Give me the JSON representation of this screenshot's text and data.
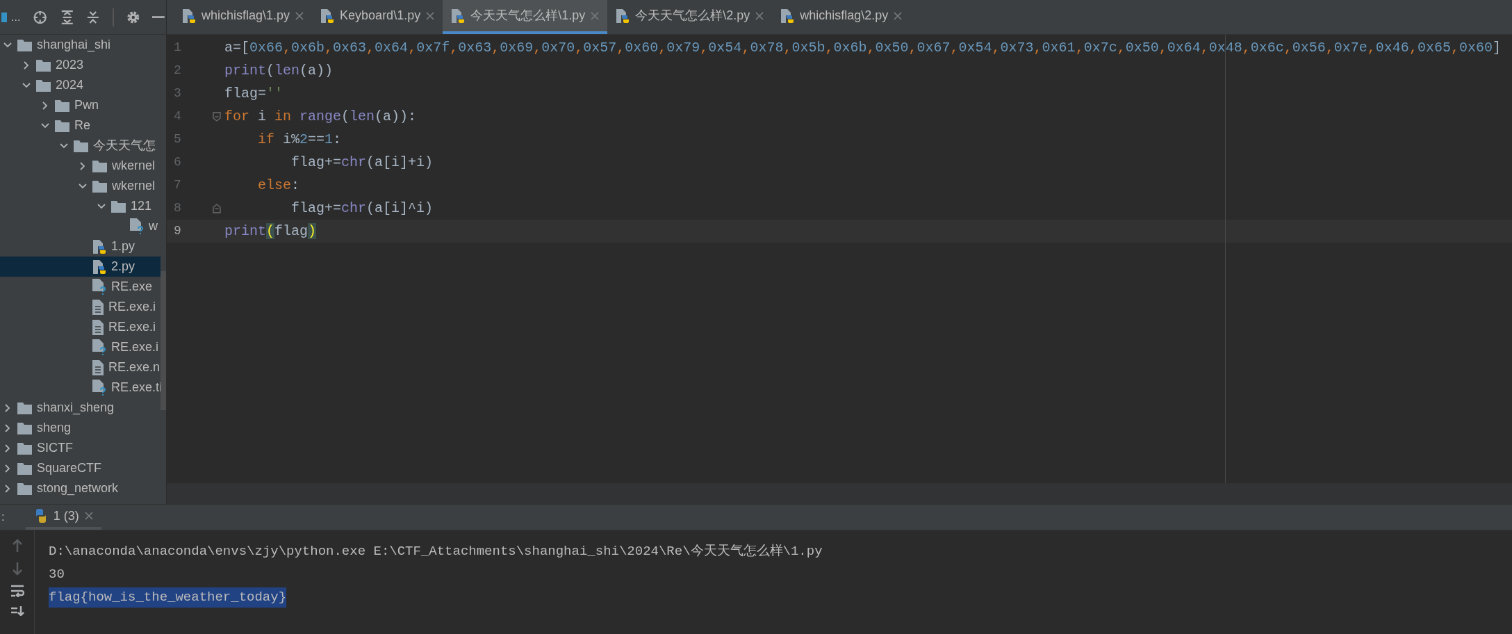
{
  "project_panel": {
    "title": "...",
    "tree": [
      {
        "label": "shanghai_shi",
        "kind": "folder",
        "expanded": true,
        "selected": false,
        "children": [
          {
            "label": "2023",
            "kind": "folder",
            "expanded": false,
            "selected": false
          },
          {
            "label": "2024",
            "kind": "folder",
            "expanded": true,
            "selected": false,
            "children": [
              {
                "label": "Pwn",
                "kind": "folder",
                "expanded": false,
                "selected": false
              },
              {
                "label": "Re",
                "kind": "folder",
                "expanded": true,
                "selected": false,
                "children": [
                  {
                    "label": "今天天气怎",
                    "kind": "folder",
                    "expanded": true,
                    "selected": false,
                    "children": [
                      {
                        "label": "wkernel",
                        "kind": "folder",
                        "expanded": false,
                        "selected": false
                      },
                      {
                        "label": "wkernel",
                        "kind": "folder",
                        "expanded": true,
                        "selected": false,
                        "children": [
                          {
                            "label": "121",
                            "kind": "folder",
                            "expanded": true,
                            "selected": false,
                            "children": [
                              {
                                "label": "w",
                                "kind": "unknown",
                                "selected": false
                              }
                            ]
                          }
                        ]
                      },
                      {
                        "label": "1.py",
                        "kind": "python",
                        "selected": false
                      },
                      {
                        "label": "2.py",
                        "kind": "python",
                        "selected": true
                      },
                      {
                        "label": "RE.exe",
                        "kind": "unknown",
                        "selected": false
                      },
                      {
                        "label": "RE.exe.i",
                        "kind": "text",
                        "selected": false
                      },
                      {
                        "label": "RE.exe.i",
                        "kind": "text",
                        "selected": false
                      },
                      {
                        "label": "RE.exe.i",
                        "kind": "unknown",
                        "selected": false
                      },
                      {
                        "label": "RE.exe.n",
                        "kind": "text",
                        "selected": false
                      },
                      {
                        "label": "RE.exe.ti",
                        "kind": "unknown",
                        "selected": false
                      }
                    ]
                  }
                ]
              }
            ]
          }
        ]
      },
      {
        "label": "shanxi_sheng",
        "kind": "folder",
        "expanded": false,
        "selected": false
      },
      {
        "label": "sheng",
        "kind": "folder",
        "expanded": false,
        "selected": false
      },
      {
        "label": "SICTF",
        "kind": "folder",
        "expanded": false,
        "selected": false
      },
      {
        "label": "SquareCTF",
        "kind": "folder",
        "expanded": false,
        "selected": false
      },
      {
        "label": "stong_network",
        "kind": "folder",
        "expanded": false,
        "selected": false
      }
    ]
  },
  "editor": {
    "tabs": [
      {
        "label": "whichisflag\\1.py",
        "selected": false
      },
      {
        "label": "Keyboard\\1.py",
        "selected": false
      },
      {
        "label": "今天天气怎么样\\1.py",
        "selected": true
      },
      {
        "label": "今天天气怎么样\\2.py",
        "selected": false
      },
      {
        "label": "whichisflag\\2.py",
        "selected": false
      }
    ],
    "lines": [
      {
        "number": "1",
        "current": false,
        "tokens": [
          {
            "text": "a=[",
            "kind": "plain"
          },
          {
            "text": "0x66",
            "kind": "number"
          },
          {
            "text": ",",
            "kind": "keyword"
          },
          {
            "text": "0x6b",
            "kind": "number"
          },
          {
            "text": ",",
            "kind": "keyword"
          },
          {
            "text": "0x63",
            "kind": "number"
          },
          {
            "text": ",",
            "kind": "keyword"
          },
          {
            "text": "0x64",
            "kind": "number"
          },
          {
            "text": ",",
            "kind": "keyword"
          },
          {
            "text": "0x7f",
            "kind": "number"
          },
          {
            "text": ",",
            "kind": "keyword"
          },
          {
            "text": "0x63",
            "kind": "number"
          },
          {
            "text": ",",
            "kind": "keyword"
          },
          {
            "text": "0x69",
            "kind": "number"
          },
          {
            "text": ",",
            "kind": "keyword"
          },
          {
            "text": "0x70",
            "kind": "number"
          },
          {
            "text": ",",
            "kind": "keyword"
          },
          {
            "text": "0x57",
            "kind": "number"
          },
          {
            "text": ",",
            "kind": "keyword"
          },
          {
            "text": "0x60",
            "kind": "number"
          },
          {
            "text": ",",
            "kind": "keyword"
          },
          {
            "text": "0x79",
            "kind": "number"
          },
          {
            "text": ",",
            "kind": "keyword"
          },
          {
            "text": "0x54",
            "kind": "number"
          },
          {
            "text": ",",
            "kind": "keyword"
          },
          {
            "text": "0x78",
            "kind": "number"
          },
          {
            "text": ",",
            "kind": "keyword"
          },
          {
            "text": "0x5b",
            "kind": "number"
          },
          {
            "text": ",",
            "kind": "keyword"
          },
          {
            "text": "0x6b",
            "kind": "number"
          },
          {
            "text": ",",
            "kind": "keyword"
          },
          {
            "text": "0x50",
            "kind": "number"
          },
          {
            "text": ",",
            "kind": "keyword"
          },
          {
            "text": "0x67",
            "kind": "number"
          },
          {
            "text": ",",
            "kind": "keyword"
          },
          {
            "text": "0x54",
            "kind": "number"
          },
          {
            "text": ",",
            "kind": "keyword"
          },
          {
            "text": "0x73",
            "kind": "number"
          },
          {
            "text": ",",
            "kind": "keyword"
          },
          {
            "text": "0x61",
            "kind": "number"
          },
          {
            "text": ",",
            "kind": "keyword"
          },
          {
            "text": "0x7c",
            "kind": "number"
          },
          {
            "text": ",",
            "kind": "keyword"
          },
          {
            "text": "0x50",
            "kind": "number"
          },
          {
            "text": ",",
            "kind": "keyword"
          },
          {
            "text": "0x64",
            "kind": "number"
          },
          {
            "text": ",",
            "kind": "keyword"
          },
          {
            "text": "0x48",
            "kind": "number"
          },
          {
            "text": ",",
            "kind": "keyword"
          },
          {
            "text": "0x6c",
            "kind": "number"
          },
          {
            "text": ",",
            "kind": "keyword"
          },
          {
            "text": "0x56",
            "kind": "number"
          },
          {
            "text": ",",
            "kind": "keyword"
          },
          {
            "text": "0x7e",
            "kind": "number"
          },
          {
            "text": ",",
            "kind": "keyword"
          },
          {
            "text": "0x46",
            "kind": "number"
          },
          {
            "text": ",",
            "kind": "keyword"
          },
          {
            "text": "0x65",
            "kind": "number"
          },
          {
            "text": ",",
            "kind": "keyword"
          },
          {
            "text": "0x60",
            "kind": "number"
          },
          {
            "text": "]",
            "kind": "plain"
          }
        ]
      },
      {
        "number": "2",
        "current": false,
        "tokens": [
          {
            "text": "print",
            "kind": "builtin"
          },
          {
            "text": "(",
            "kind": "plain"
          },
          {
            "text": "len",
            "kind": "builtin"
          },
          {
            "text": "(a))",
            "kind": "plain"
          }
        ]
      },
      {
        "number": "3",
        "current": false,
        "tokens": [
          {
            "text": "flag=",
            "kind": "plain"
          },
          {
            "text": "''",
            "kind": "string"
          }
        ]
      },
      {
        "number": "4",
        "current": false,
        "fold_start": true,
        "tokens": [
          {
            "text": "for",
            "kind": "keyword"
          },
          {
            "text": " i ",
            "kind": "plain"
          },
          {
            "text": "in",
            "kind": "keyword"
          },
          {
            "text": " range",
            "kind": "builtin"
          },
          {
            "text": "(",
            "kind": "plain"
          },
          {
            "text": "len",
            "kind": "builtin"
          },
          {
            "text": "(a)):",
            "kind": "plain"
          }
        ]
      },
      {
        "number": "5",
        "current": false,
        "tokens": [
          {
            "text": "    if",
            "kind": "keyword"
          },
          {
            "text": " i%",
            "kind": "plain"
          },
          {
            "text": "2",
            "kind": "number"
          },
          {
            "text": "==",
            "kind": "plain"
          },
          {
            "text": "1",
            "kind": "number"
          },
          {
            "text": ":",
            "kind": "plain"
          }
        ]
      },
      {
        "number": "6",
        "current": false,
        "tokens": [
          {
            "text": "        flag+=",
            "kind": "plain"
          },
          {
            "text": "chr",
            "kind": "builtin"
          },
          {
            "text": "(a[i]+i)",
            "kind": "plain"
          }
        ]
      },
      {
        "number": "7",
        "current": false,
        "tokens": [
          {
            "text": "    else",
            "kind": "keyword"
          },
          {
            "text": ":",
            "kind": "plain"
          }
        ]
      },
      {
        "number": "8",
        "current": false,
        "fold_end": true,
        "tokens": [
          {
            "text": "        flag+=",
            "kind": "plain"
          },
          {
            "text": "chr",
            "kind": "builtin"
          },
          {
            "text": "(a[i]^i)",
            "kind": "plain"
          }
        ]
      },
      {
        "number": "9",
        "current": true,
        "tokens": [
          {
            "text": "print",
            "kind": "builtin"
          },
          {
            "text": "(",
            "kind": "match"
          },
          {
            "text": "flag",
            "kind": "plain"
          },
          {
            "text": ")",
            "kind": "match"
          }
        ]
      }
    ]
  },
  "run_panel": {
    "label": ":",
    "tabs": [
      {
        "label": "1 (3)",
        "selected": true
      }
    ],
    "output": [
      {
        "text": "D:\\anaconda\\anaconda\\envs\\zjy\\python.exe E:\\CTF_Attachments\\shanghai_shi\\2024\\Re\\今天天气怎么样\\1.py",
        "selected": false
      },
      {
        "text": "30",
        "selected": false
      },
      {
        "text": "flag{how_is_the_weather_today}",
        "selected": true
      }
    ]
  }
}
